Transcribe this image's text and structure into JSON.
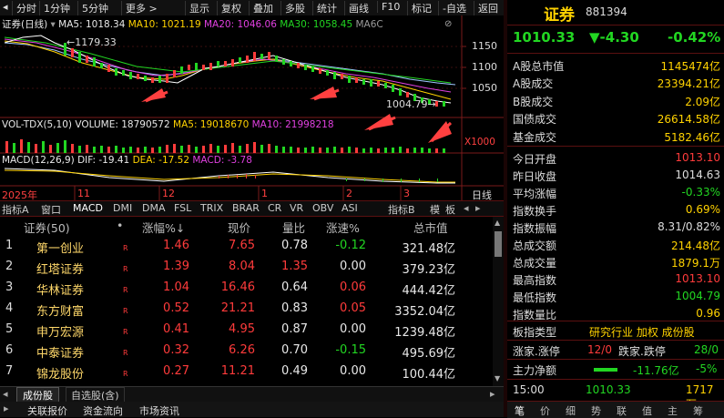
{
  "toolbar": {
    "items": [
      "分时",
      "1分钟",
      "5分钟",
      "更多 >",
      "显示",
      "复权",
      "叠加",
      "多股",
      "统计",
      "画线",
      "F10",
      "标记",
      "-自选",
      "返回"
    ]
  },
  "chart": {
    "title": "证券(日线)",
    "ma5": "MA5: 1018.34",
    "ma10": "MA10: 1021.19",
    "ma20": "MA20: 1046.06",
    "ma30": "MA30: 1058.45",
    "ma60": "MA6C",
    "high_label": "1179.33",
    "low_label": "1004.79",
    "y_ticks": [
      "1150",
      "1100",
      "1050"
    ],
    "vol_legend": "VOL-TDX(5,10)",
    "volume": "VOLUME: 18790572",
    "vol_ma5": "MA5: 19018670",
    "vol_ma10": "MA10: 21998218",
    "vol_unit": "X1000",
    "macd_legend": "MACD(12,26,9)",
    "dif": "DIF: -19.41",
    "dea": "DEA: -17.52",
    "macd": "MACD: -3.78",
    "dates": [
      "2025年",
      "11",
      "12",
      "1",
      "2",
      "3"
    ],
    "period": "日线"
  },
  "tabs": [
    "指标A",
    "窗口",
    "MACD",
    "DMI",
    "DMA",
    "FSL",
    "TRIX",
    "BRAR",
    "CR",
    "VR",
    "OBV",
    "ASI",
    "指标B",
    "模",
    "板"
  ],
  "table": {
    "headers": {
      "name": "证券(50)",
      "dot": "•",
      "pct": "涨幅%↓",
      "price": "现价",
      "ratio": "量比",
      "speed": "涨速%",
      "cap": "总市值"
    },
    "rows": [
      {
        "num": "1",
        "name": "第一创业",
        "mark": "R",
        "pct": "1.46",
        "price": "7.65",
        "ratio": "0.78",
        "speed": "-0.12",
        "cap": "321.48亿"
      },
      {
        "num": "2",
        "name": "红塔证券",
        "mark": "R",
        "pct": "1.39",
        "price": "8.04",
        "ratio": "1.35",
        "speed": "0.00",
        "cap": "379.23亿"
      },
      {
        "num": "3",
        "name": "华林证券",
        "mark": "R",
        "pct": "1.04",
        "price": "16.46",
        "ratio": "0.64",
        "speed": "0.06",
        "cap": "444.42亿"
      },
      {
        "num": "4",
        "name": "东方财富",
        "mark": "R",
        "pct": "0.52",
        "price": "21.21",
        "ratio": "0.83",
        "speed": "0.05",
        "cap": "3352.04亿"
      },
      {
        "num": "5",
        "name": "申万宏源",
        "mark": "R",
        "pct": "0.41",
        "price": "4.95",
        "ratio": "0.87",
        "speed": "0.00",
        "cap": "1239.48亿"
      },
      {
        "num": "6",
        "name": "中泰证券",
        "mark": "R",
        "pct": "0.32",
        "price": "6.26",
        "ratio": "0.70",
        "speed": "-0.15",
        "cap": "495.69亿"
      },
      {
        "num": "7",
        "name": "锦龙股份",
        "mark": "R",
        "pct": "0.27",
        "price": "11.21",
        "ratio": "0.49",
        "speed": "0.00",
        "cap": "100.44亿"
      }
    ]
  },
  "bottom_tabs": [
    "成份股",
    "自选股(含)"
  ],
  "status_bar": [
    "关联报价",
    "资金流向",
    "市场资讯"
  ],
  "right": {
    "name": "证券",
    "code": "881394",
    "price": "1010.33",
    "change": "▼-4.30",
    "pct": "-0.42%",
    "stats1": [
      {
        "k": "A股总市值",
        "v": "1145474亿"
      },
      {
        "k": "A股成交",
        "v": "23394.21亿"
      },
      {
        "k": "B股成交",
        "v": "2.09亿"
      },
      {
        "k": "国债成交",
        "v": "26614.58亿"
      },
      {
        "k": "基金成交",
        "v": "5182.46亿"
      }
    ],
    "stats2": [
      {
        "k": "今日开盘",
        "v": "1013.10"
      },
      {
        "k": "昨日收盘",
        "v": "1014.63"
      },
      {
        "k": "平均涨幅",
        "v": "-0.33%"
      },
      {
        "k": "指数换手",
        "v": "0.69%"
      },
      {
        "k": "指数振幅",
        "v": "8.31/0.82%"
      },
      {
        "k": "总成交额",
        "v": "214.48亿"
      },
      {
        "k": "总成交量",
        "v": "1879.1万"
      },
      {
        "k": "最高指数",
        "v": "1013.10"
      },
      {
        "k": "最低指数",
        "v": "1004.79"
      },
      {
        "k": "指数量比",
        "v": "0.96"
      }
    ],
    "board_type_label": "板指类型",
    "board_type_value": "研究行业 加权 成份股",
    "rise_label": "涨家.涨停",
    "rise_value": "12/0",
    "fall_label": "跌家.跌停",
    "fall_value": "28/0",
    "net_label": "主力净额",
    "net_value": "-11.76亿",
    "net_pct": "-5%",
    "tick_time": "15:00",
    "tick_price": "1010.33",
    "tick_vol": "1717万",
    "bottom_tabs": [
      "笔",
      "价",
      "细",
      "势",
      "联",
      "值",
      "主",
      "筹"
    ]
  },
  "colors": {
    "up": "#ff3b3b",
    "down": "#22d622",
    "name": "#ffd86a",
    "accent": "#ffd200"
  }
}
